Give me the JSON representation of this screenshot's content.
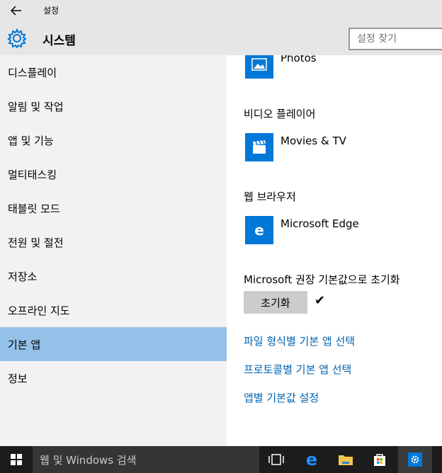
{
  "window": {
    "title": "설정"
  },
  "header": {
    "title": "시스템",
    "search_placeholder": "설정 찾기"
  },
  "sidebar": {
    "items": [
      {
        "label": "디스플레이"
      },
      {
        "label": "알림 및 작업"
      },
      {
        "label": "앱 및 기능"
      },
      {
        "label": "멀티태스킹"
      },
      {
        "label": "태블릿 모드"
      },
      {
        "label": "전원 및 절전"
      },
      {
        "label": "저장소"
      },
      {
        "label": "오프라인 지도"
      },
      {
        "label": "기본 앱",
        "selected": true
      },
      {
        "label": "정보"
      }
    ]
  },
  "main": {
    "photos_app": "Photos",
    "video_heading": "비디오 플레이어",
    "video_app": "Movies & TV",
    "browser_heading": "웹 브라우저",
    "browser_app": "Microsoft Edge",
    "reset_heading": "Microsoft 권장 기본값으로 초기화",
    "reset_button": "초기화",
    "reset_done_icon": "checkmark-icon",
    "links": [
      "파일 형식별 기본 앱 선택",
      "프로토콜별 기본 앱 선택",
      "앱별 기본값 설정"
    ]
  },
  "taskbar": {
    "search_placeholder": "웹 및 Windows 검색",
    "icons": [
      "windows-logo-icon",
      "task-view-icon",
      "edge-icon",
      "file-explorer-icon",
      "store-icon",
      "settings-icon"
    ]
  },
  "colors": {
    "accent": "#0078d7",
    "selected_nav": "#93c1e8",
    "link": "#0063b1",
    "taskbar": "#1c1c1c"
  }
}
